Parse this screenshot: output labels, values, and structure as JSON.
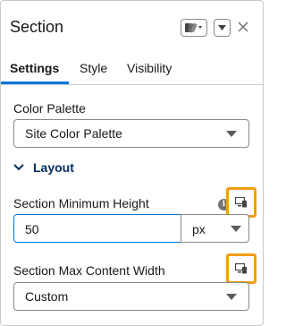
{
  "header": {
    "title": "Section",
    "style_button_icon": "paint-swatch-icon",
    "menu_button_icon": "chevron-down-icon",
    "close_icon": "close-icon"
  },
  "tabs": [
    {
      "label": "Settings",
      "active": true
    },
    {
      "label": "Style",
      "active": false
    },
    {
      "label": "Visibility",
      "active": false
    }
  ],
  "color_palette": {
    "label": "Color Palette",
    "value": "Site Color Palette"
  },
  "layout": {
    "label": "Layout",
    "expanded": true
  },
  "min_height": {
    "label": "Section Minimum Height",
    "value": "50",
    "unit": "px"
  },
  "max_width": {
    "label": "Section Max Content Width",
    "value": "Custom"
  },
  "colors": {
    "accent": "#0176d3",
    "highlight": "#f39c12",
    "section_heading": "#032d60"
  }
}
